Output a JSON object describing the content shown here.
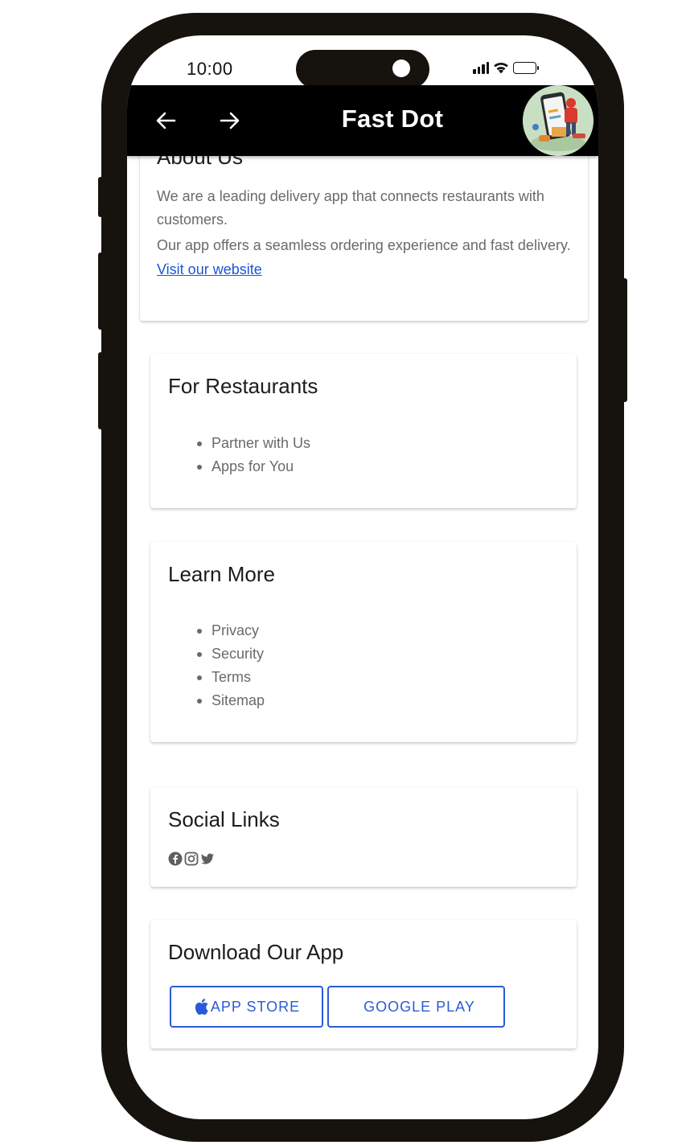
{
  "status_bar": {
    "time": "10:00"
  },
  "appbar": {
    "title": "Fast Dot",
    "back_icon": "arrow-left-icon",
    "forward_icon": "arrow-right-icon",
    "avatar": "delivery-app-logo"
  },
  "about": {
    "title": "About Us",
    "paragraph_1": "We are a leading delivery app that connects restaurants with customers.",
    "paragraph_2": "Our app offers a seamless ordering experience and fast delivery.",
    "link_label": "Visit our website"
  },
  "restaurants": {
    "title": "For Restaurants",
    "items": [
      "Partner with Us",
      "Apps for You"
    ]
  },
  "learn_more": {
    "title": "Learn More",
    "items": [
      "Privacy",
      "Security",
      "Terms",
      "Sitemap"
    ]
  },
  "social": {
    "title": "Social Links",
    "icons": [
      "facebook-icon",
      "instagram-icon",
      "twitter-icon"
    ]
  },
  "download": {
    "title": "Download Our App",
    "app_store_label": "APP STORE",
    "google_play_label": "GOOGLE PLAY"
  },
  "colors": {
    "appbar_bg": "#000000",
    "link": "#1a56db",
    "button_accent": "#2a5bd7",
    "phone_frame": "#16120e"
  }
}
